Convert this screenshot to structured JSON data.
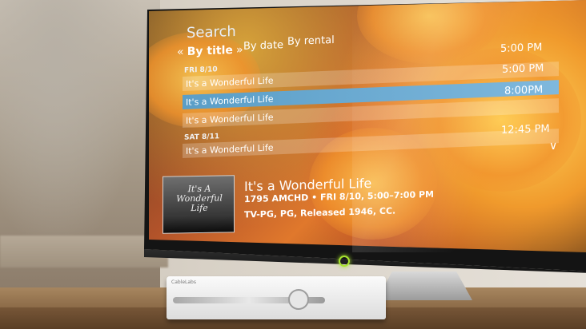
{
  "menu": {
    "title": "Search",
    "prev_chevron": "«",
    "next_chevron": "»",
    "tabs": [
      {
        "label": "By title",
        "active": true
      },
      {
        "label": "By date",
        "active": false
      },
      {
        "label": "By rental",
        "active": false
      }
    ]
  },
  "listings": {
    "header_time": "5:00 PM",
    "groups": [
      {
        "day": "FRI 8/10",
        "rows": [
          {
            "title": "It's a Wonderful Life",
            "time": "5:00 PM",
            "selected": false
          },
          {
            "title": "It's a Wonderful Life",
            "time": "8:00PM",
            "selected": true
          },
          {
            "title": "It's a Wonderful Life",
            "time": "",
            "selected": false
          }
        ]
      },
      {
        "day": "SAT 8/11",
        "rows": [
          {
            "title": "It's a Wonderful Life",
            "time": "12:45 PM",
            "selected": false
          }
        ]
      }
    ],
    "scroll_down_icon": "chevron-down-icon"
  },
  "details": {
    "poster_text": "It's A Wonderful Life",
    "title": "It's a Wonderful Life",
    "subtitle": "1795 AMCHD • FRI 8/10, 5:00–7:00 PM",
    "info": "TV-PG, PG, Released 1946, CC."
  },
  "device": {
    "power_led_color": "#a9e52f",
    "stb_brand": "CableLabs",
    "selection_color": "#5a9ec7"
  }
}
